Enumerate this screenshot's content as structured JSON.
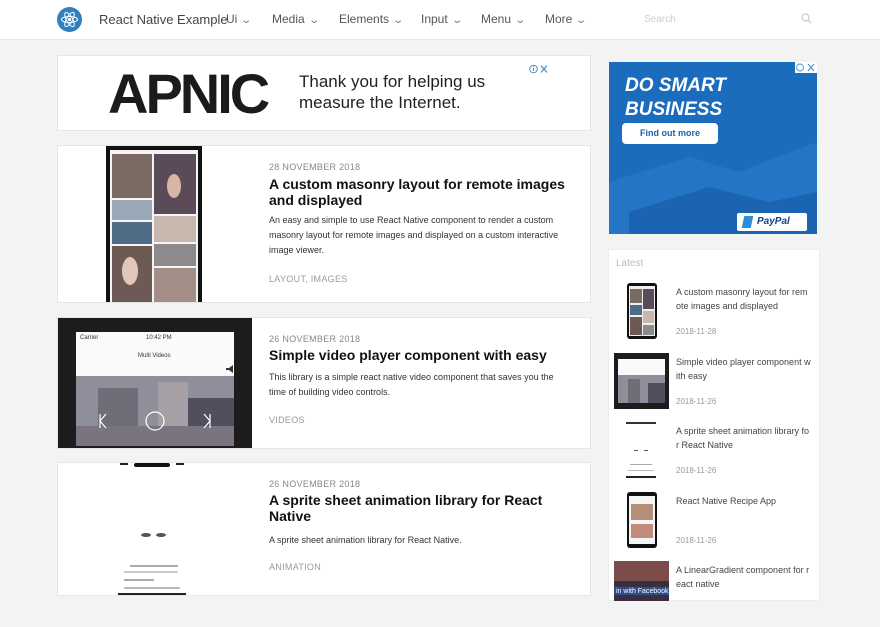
{
  "nav": {
    "brand": "React Native Example",
    "menu": [
      {
        "label": "Ui"
      },
      {
        "label": "Media"
      },
      {
        "label": "Elements"
      },
      {
        "label": "Input"
      },
      {
        "label": "Menu"
      },
      {
        "label": "More"
      }
    ],
    "search_placeholder": "Search"
  },
  "ad_banner": {
    "logo_text": "APNIC",
    "message_line1": "Thank you for helping us",
    "message_line2": "measure the Internet."
  },
  "posts": [
    {
      "date": "28 NOVEMBER 2018",
      "title": "A custom masonry layout for remote images and displayed",
      "excerpt": "An easy and simple to use React Native component to render a custom masonry layout for remote images and displayed on a custom interactive image viewer.",
      "tags": "LAYOUT, IMAGES"
    },
    {
      "date": "26 NOVEMBER 2018",
      "title": "Simple video player component with easy",
      "excerpt": "This library is a simple react native video component that saves you the time of building video controls.",
      "tags": "VIDEOS",
      "thumb_status_left": "Carrier",
      "thumb_status_time": "10:42 PM",
      "thumb_label": "Multi Videos"
    },
    {
      "date": "26 NOVEMBER 2018",
      "title": "A sprite sheet animation library for React Native",
      "excerpt": "A sprite sheet animation library for React Native.",
      "tags": "ANIMATION"
    }
  ],
  "sidebar_ad": {
    "headline_line1": "DO SMART",
    "headline_line2": "BUSINESS",
    "cta": "Find out more",
    "brand": "PayPal"
  },
  "latest": {
    "heading": "Latest",
    "items": [
      {
        "title": "A custom masonry layout for remote images and displayed",
        "date": "2018-11-28"
      },
      {
        "title": "Simple video player component with easy",
        "date": "2018-11-26"
      },
      {
        "title": "A sprite sheet animation library for React Native",
        "date": "2018-11-26"
      },
      {
        "title": "React Native Recipe App",
        "date": "2018-11-26"
      },
      {
        "title": "A LinearGradient component for react native",
        "date": "",
        "thumb_caption": "in with Facebook"
      }
    ]
  },
  "colors": {
    "brand_blue": "#2f7fc1",
    "ad_blue": "#1d6fc0",
    "page_bg": "#f3f3f3"
  }
}
